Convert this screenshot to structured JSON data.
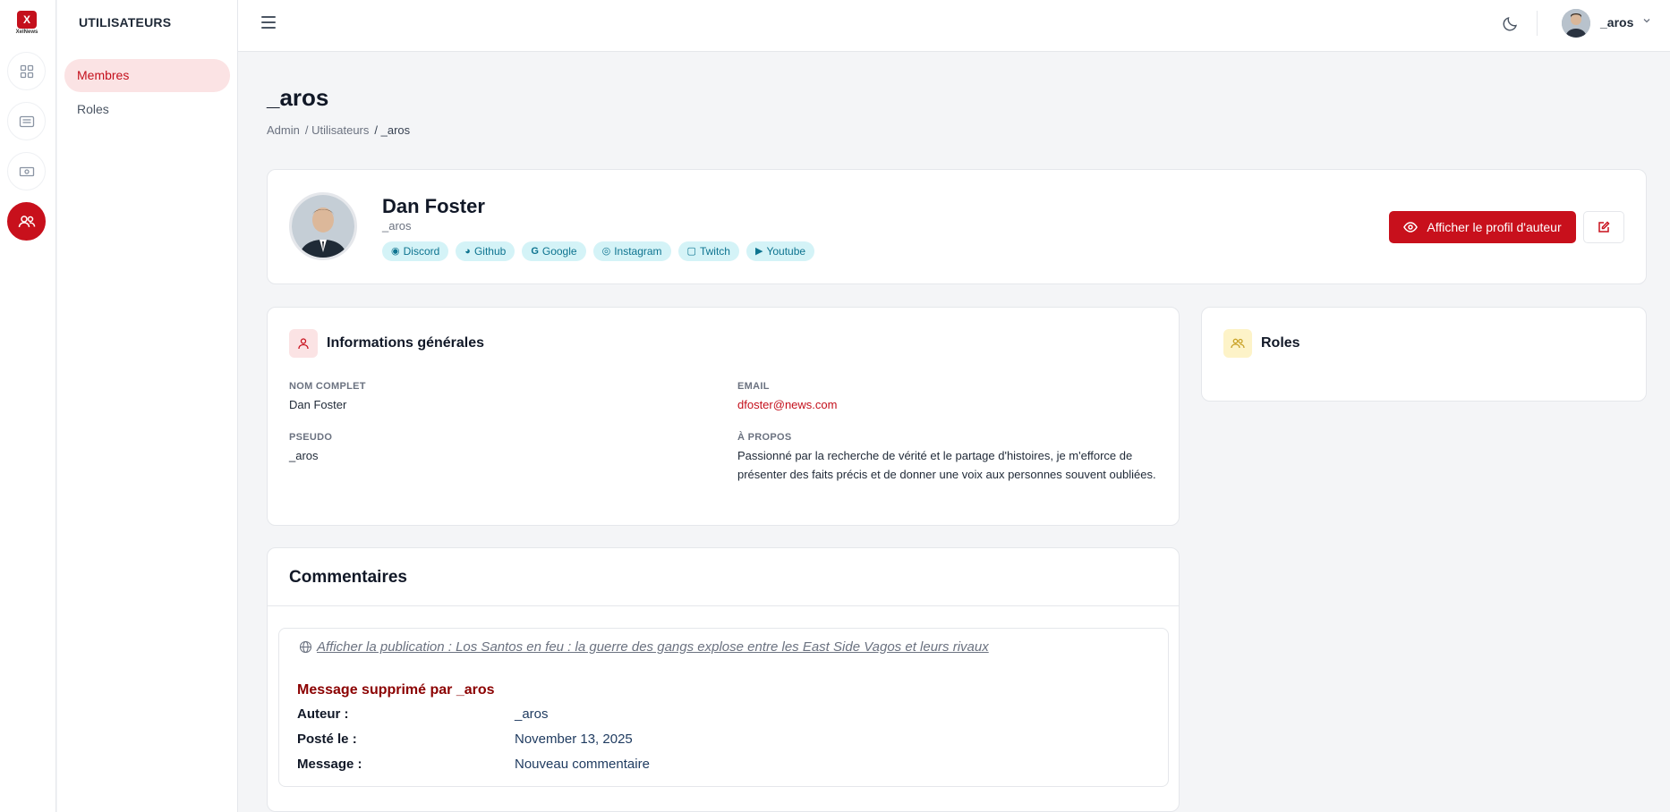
{
  "brand": {
    "logo_text": "XelNews"
  },
  "subnav": {
    "title": "UTILISATEURS",
    "items": [
      {
        "label": "Membres"
      },
      {
        "label": "Roles"
      }
    ]
  },
  "topbar": {
    "user": "_aros"
  },
  "page": {
    "title": "_aros",
    "breadcrumb": [
      "Admin",
      "/ Utilisateurs",
      "/ _aros"
    ]
  },
  "profile": {
    "name": "Dan Foster",
    "handle": "_aros",
    "socials": [
      {
        "label": "Discord",
        "icon": "discord-icon"
      },
      {
        "label": "Github",
        "icon": "github-icon"
      },
      {
        "label": "Google",
        "icon": "google-icon"
      },
      {
        "label": "Instagram",
        "icon": "instagram-icon"
      },
      {
        "label": "Twitch",
        "icon": "twitch-icon"
      },
      {
        "label": "Youtube",
        "icon": "youtube-icon"
      }
    ],
    "view_author_label": "Afficher le profil d'auteur"
  },
  "info": {
    "title": "Informations générales",
    "full_name_label": "NOM COMPLET",
    "full_name": "Dan Foster",
    "email_label": "EMAIL",
    "email": "dfoster@news.com",
    "pseudo_label": "PSEUDO",
    "pseudo": "_aros",
    "about_label": "À PROPOS",
    "about": "Passionné par la recherche de vérité et le partage d'histoires, je m'efforce de présenter des faits précis et de donner une voix aux personnes souvent oubliées."
  },
  "roles": {
    "title": "Roles"
  },
  "comments": {
    "title": "Commentaires",
    "items": [
      {
        "publication_link": "Afficher la publication : Los Santos en feu : la guerre des gangs explose entre les East Side Vagos et leurs rivaux",
        "deleted_by": "Message supprimé par _aros",
        "author_label": "Auteur :",
        "author": "_aros",
        "posted_label": "Posté le :",
        "posted": "November 13, 2025",
        "message_label": "Message :",
        "message": "Nouveau commentaire"
      }
    ]
  },
  "colors": {
    "accent": "#c8101c",
    "social_bg": "#d4f3f7",
    "social_text": "#0e7490"
  }
}
